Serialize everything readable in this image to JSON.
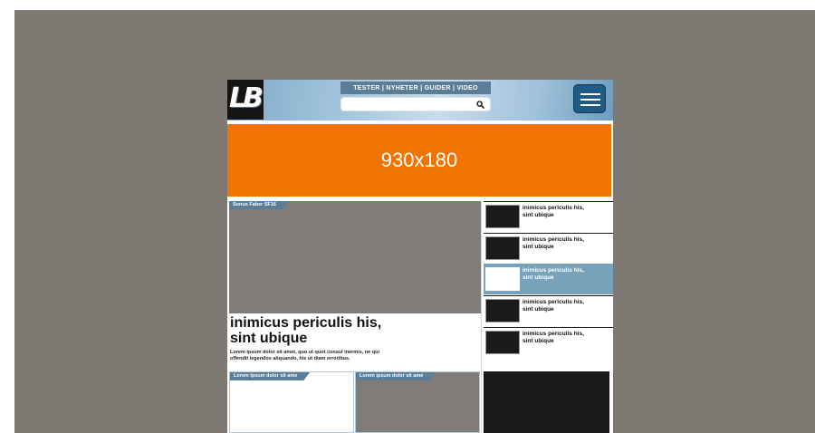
{
  "header": {
    "logo_text": "LB",
    "nav_label": "TESTER | NYHETER | GUIDER | VIDEO",
    "search": {
      "value": "",
      "placeholder": ""
    },
    "icons": {
      "search": "search-icon",
      "menu": "hamburger-menu-icon"
    }
  },
  "ad": {
    "label": "930x180",
    "color": "#f07400"
  },
  "feature": {
    "tag": "Sonus Faber SF16",
    "title_line1": "inimicus periculis his,",
    "title_line2": "sint ubique",
    "summary_line1": "Lorem ipsum dolor sit amet, quo ut quot consul inermis, ne qui",
    "summary_line2": "offendit legendos aliquando, his ut diam erroribus."
  },
  "sidebar": {
    "items": [
      {
        "line1": "inimicus periculis his,",
        "line2": "sint ubique"
      },
      {
        "line1": "inimicus periculis his,",
        "line2": "sint ubique"
      },
      {
        "line1": "inimicus periculis his,",
        "line2": "sint ubique"
      },
      {
        "line1": "inimicus periculis his,",
        "line2": "sint ubique"
      },
      {
        "line1": "inimicus periculis his,",
        "line2": "sint ubique"
      }
    ],
    "active_index": 2,
    "active_color": "#78a2ba"
  },
  "bottom_cards": [
    {
      "tag": "Lorem ipsum dolor sit ame"
    },
    {
      "tag": "Lorem ipsum dolor sit ame"
    }
  ],
  "colors": {
    "backdrop": "#7f7974",
    "accent": "#5b7e98",
    "menu_button": "#1f5a84"
  }
}
